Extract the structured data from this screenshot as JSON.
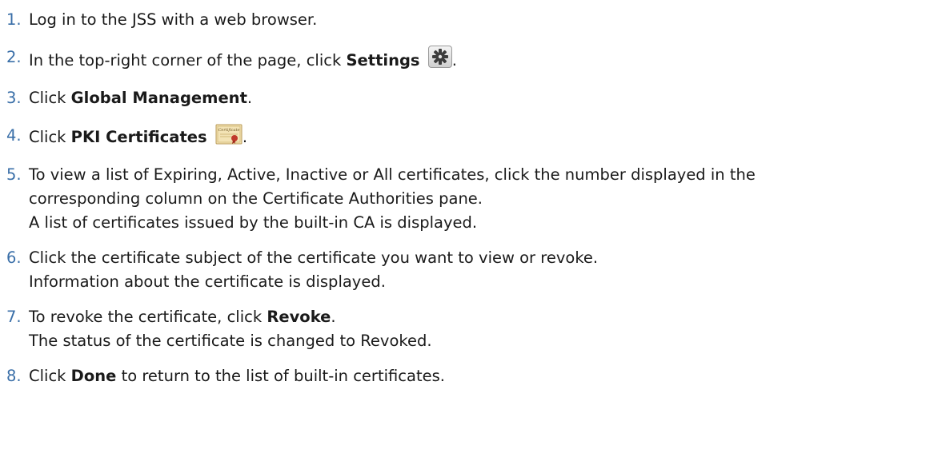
{
  "steps": [
    {
      "number": "1.",
      "segments": [
        {
          "text": "Log in to the JSS with a web browser.",
          "bold": false
        }
      ]
    },
    {
      "number": "2.",
      "segments": [
        {
          "text": "In the top-right corner of the page, click ",
          "bold": false
        },
        {
          "text": "Settings",
          "bold": true
        }
      ],
      "icon": "gear-icon",
      "after_icon": "."
    },
    {
      "number": "3.",
      "segments": [
        {
          "text": "Click ",
          "bold": false
        },
        {
          "text": "Global Management",
          "bold": true
        },
        {
          "text": ".",
          "bold": false
        }
      ]
    },
    {
      "number": "4.",
      "segments": [
        {
          "text": "Click ",
          "bold": false
        },
        {
          "text": "PKI Certificates",
          "bold": true
        }
      ],
      "icon": "certificate-icon",
      "after_icon": "."
    },
    {
      "number": "5.",
      "lines": [
        "To view a list of Expiring, Active, Inactive or All certificates, click the number displayed in the",
        "corresponding column on the Certificate Authorities pane.",
        "A list of certificates issued by the built-in CA is displayed."
      ]
    },
    {
      "number": "6.",
      "lines": [
        "Click the certificate subject of the certificate you want to view or revoke.",
        "Information about the certificate is displayed."
      ]
    },
    {
      "number": "7.",
      "segments": [
        {
          "text": "To revoke the certificate, click ",
          "bold": false
        },
        {
          "text": "Revoke",
          "bold": true
        },
        {
          "text": ".",
          "bold": false
        }
      ],
      "extra_line": "The status of the certificate is changed to Revoked."
    },
    {
      "number": "8.",
      "segments": [
        {
          "text": "Click ",
          "bold": false
        },
        {
          "text": "Done",
          "bold": true
        },
        {
          "text": " to return to the list of built-in certificates.",
          "bold": false
        }
      ]
    }
  ],
  "icon_text": {
    "certificate_label": "Certificate"
  },
  "colors": {
    "number": "#3a6fa8",
    "text": "#1a1a1a",
    "certificate_paper": "#f3e3b5",
    "certificate_seal": "#c0392b"
  }
}
